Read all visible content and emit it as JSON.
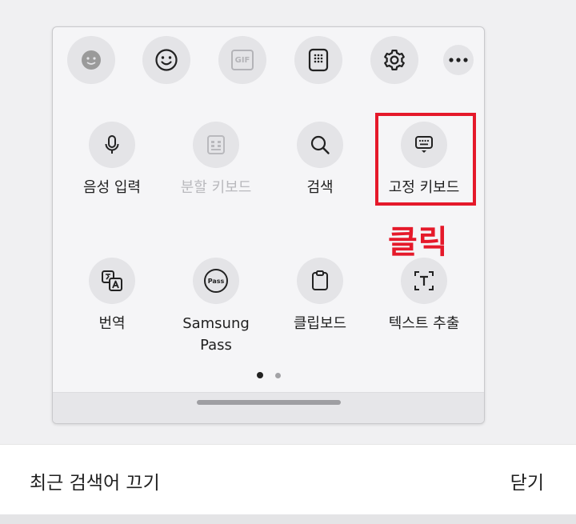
{
  "toolbar": {
    "gif_label": "GIF"
  },
  "tiles": [
    {
      "label": "음성 입력"
    },
    {
      "label": "분할 키보드"
    },
    {
      "label": "검색"
    },
    {
      "label": "고정 키보드"
    },
    {
      "label": "번역"
    },
    {
      "label": "Samsung\nPass"
    },
    {
      "label": "클립보드"
    },
    {
      "label": "텍스트 추출"
    }
  ],
  "pass_icon_text": "Pass",
  "annotation": {
    "click_label": "클릭",
    "color": "#e5192a"
  },
  "pager": {
    "current": 1,
    "total": 2
  },
  "bottom_bar": {
    "left": "최근 검색어 끄기",
    "right": "닫기"
  }
}
